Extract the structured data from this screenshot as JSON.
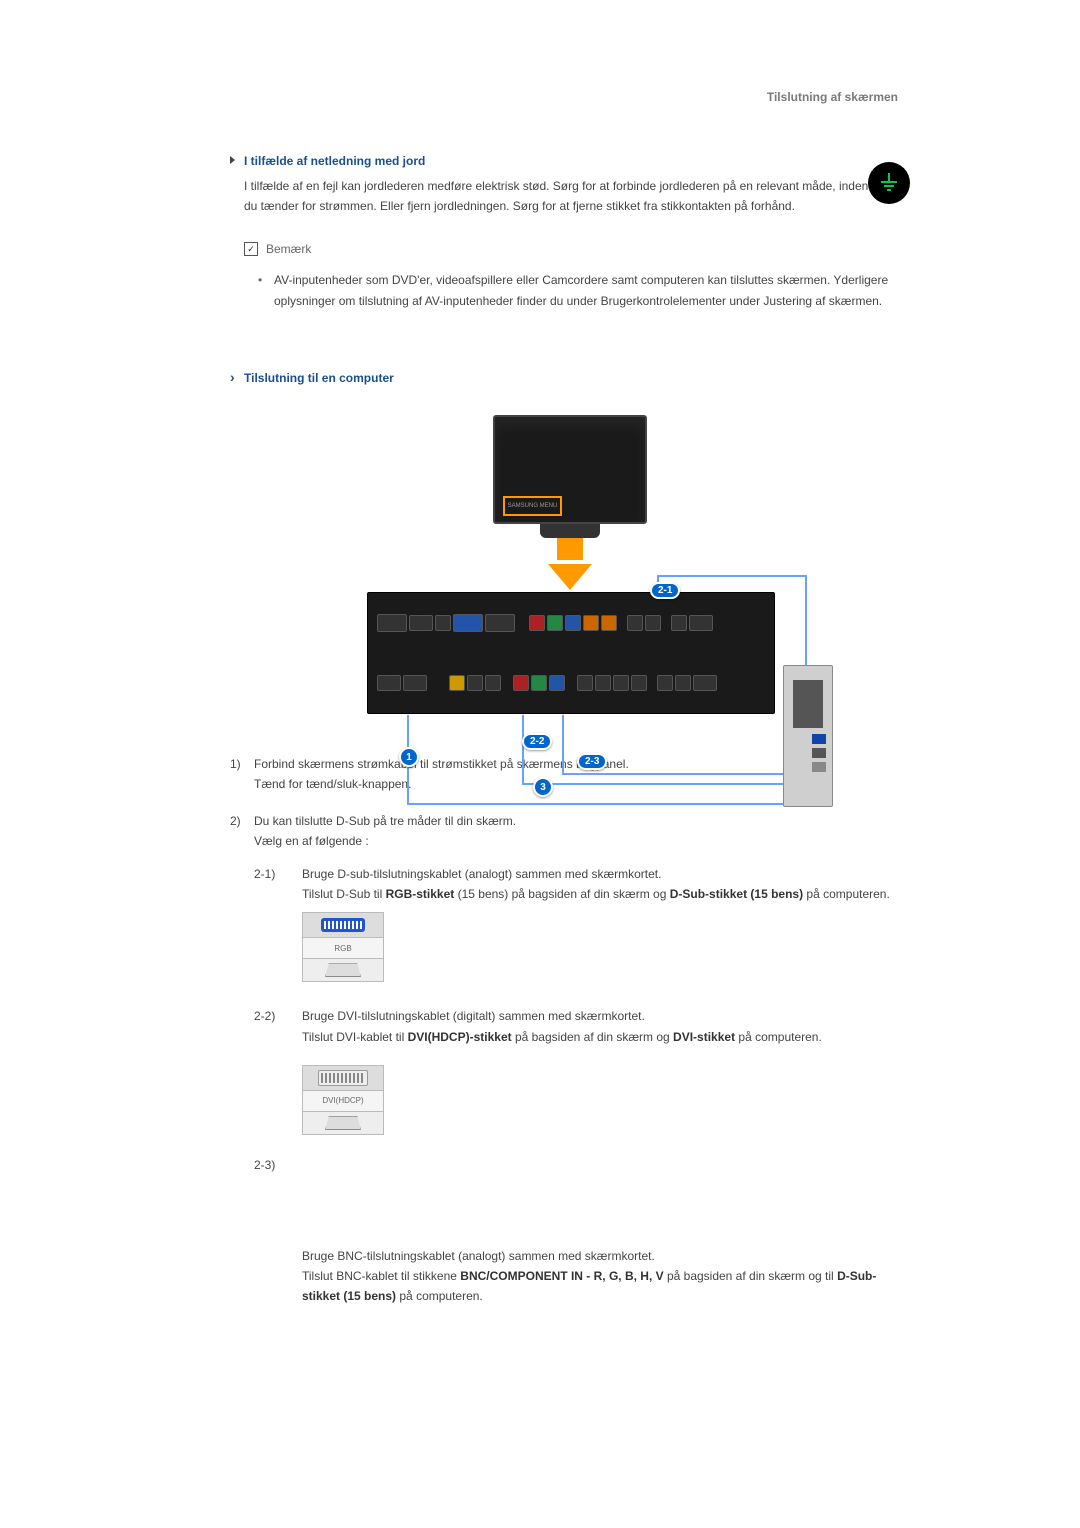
{
  "header": {
    "title": "Tilslutning af skærmen"
  },
  "section1": {
    "heading": "I tilfælde af netledning med jord",
    "body": "I tilfælde af en fejl kan jordlederen medføre elektrisk stød. Sørg for at forbinde jordlederen på en relevant måde, inden du tænder for strømmen. Eller fjern jordledningen. Sørg for at fjerne stikket fra stikkontakten på forhånd."
  },
  "note": {
    "label": "Bemærk",
    "items": [
      "AV-inputenheder som DVD'er, videoafspillere eller Camcordere samt computeren kan tilsluttes skærmen. Yderligere oplysninger om tilslutning af AV-inputenheder finder du under Brugerkontrolelementer under Justering af skærmen."
    ]
  },
  "section2": {
    "heading": "Tilslutning til en computer",
    "monitorTag": "SAMSUNG MENU",
    "badges": {
      "b21": "2-1",
      "b22": "2-2",
      "b23": "2-3",
      "b1": "1",
      "b3": "3"
    }
  },
  "steps": [
    {
      "num": "1)",
      "lines": [
        "Forbind skærmens strømkabel til strømstikket på skærmens bagpanel.",
        "Tænd for tænd/sluk-knappen."
      ]
    },
    {
      "num": "2)",
      "lines": [
        "Du kan tilslutte D-Sub på tre måder til din skærm.",
        "Vælg en af følgende :"
      ],
      "subs": [
        {
          "num": "2-1)",
          "title": "Bruge D-sub-tilslutningskablet (analogt) sammen med skærmkortet.",
          "prefix": "Tilslut D-Sub til ",
          "bold1": "RGB-stikket",
          "mid": " (15 bens) på bagsiden af din skærm og ",
          "bold2": "D-Sub-stikket (15 bens)",
          "suffix": " på computeren.",
          "connector": "rgb",
          "connectorLabel": "RGB"
        },
        {
          "num": "2-2)",
          "title": "Bruge DVI-tilslutningskablet (digitalt) sammen med skærmkortet.",
          "prefix": "Tilslut DVI-kablet til ",
          "bold1": "DVI(HDCP)-stikket",
          "mid": " på bagsiden af din skærm og ",
          "bold2": "DVI-stikket",
          "suffix": " på computeren.",
          "connector": "dvi",
          "connectorLabel": "DVI(HDCP)"
        },
        {
          "num": "2-3)",
          "title": "",
          "prefix": "",
          "bold1": "",
          "mid": "",
          "bold2": "",
          "suffix": "",
          "connector": "",
          "connectorLabel": "",
          "extraTitle": "Bruge BNC-tilslutningskablet (analogt) sammen med skærmkortet.",
          "extraPrefix": "Tilslut BNC-kablet til stikkene ",
          "extraBold1": "BNC/COMPONENT IN - R, G, B, H, V",
          "extraMid": " på bagsiden af din skærm og til ",
          "extraBold2": "D-Sub-stikket (15 bens)",
          "extraSuffix": " på computeren."
        }
      ]
    }
  ]
}
